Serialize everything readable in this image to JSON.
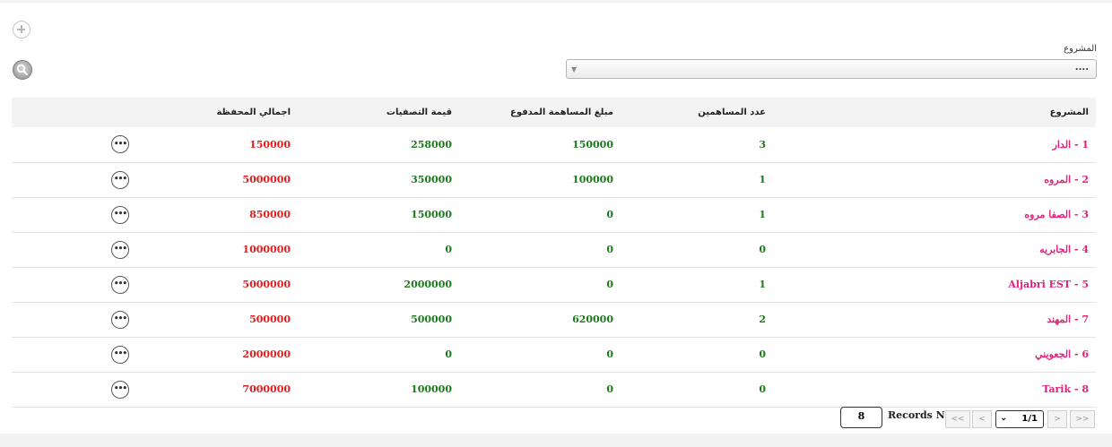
{
  "filter": {
    "label": "المشروع",
    "value": "...."
  },
  "table": {
    "headers": {
      "project": "المشروع",
      "contributors": "عدد المساهمين",
      "paid": "مبلغ المساهمة المدفوع",
      "settlements": "قيمة التصفيات",
      "total": "اجمالي المحفظة"
    },
    "rows": [
      {
        "project": "1 - الدار",
        "contributors": "3",
        "paid": "150000",
        "settlements": "258000",
        "total": "150000"
      },
      {
        "project": "2 - المروه",
        "contributors": "1",
        "paid": "100000",
        "settlements": "350000",
        "total": "5000000"
      },
      {
        "project": "3 - الصفا مروه",
        "contributors": "1",
        "paid": "0",
        "settlements": "150000",
        "total": "850000"
      },
      {
        "project": "4 - الجابريه",
        "contributors": "0",
        "paid": "0",
        "settlements": "0",
        "total": "1000000"
      },
      {
        "project": "5 - Aljabri EST",
        "contributors": "1",
        "paid": "0",
        "settlements": "2000000",
        "total": "5000000"
      },
      {
        "project": "7 - المهند",
        "contributors": "2",
        "paid": "620000",
        "settlements": "500000",
        "total": "500000"
      },
      {
        "project": "6 - الجعويني",
        "contributors": "0",
        "paid": "0",
        "settlements": "0",
        "total": "2000000"
      },
      {
        "project": "8 - Tarik",
        "contributors": "0",
        "paid": "0",
        "settlements": "100000",
        "total": "7000000"
      }
    ],
    "more_label": "•••"
  },
  "pager": {
    "records_count": "8",
    "records_label": "Records No",
    "page": "1/1",
    "first": "<<",
    "prev": "<",
    "next": ">",
    "last": ">>"
  },
  "icons": {
    "add": "add-circle-icon",
    "search": "search-icon"
  },
  "colors": {
    "project_text": "#e0227a",
    "green_values": "#1b7a1b",
    "red_values": "#e41b1b"
  }
}
